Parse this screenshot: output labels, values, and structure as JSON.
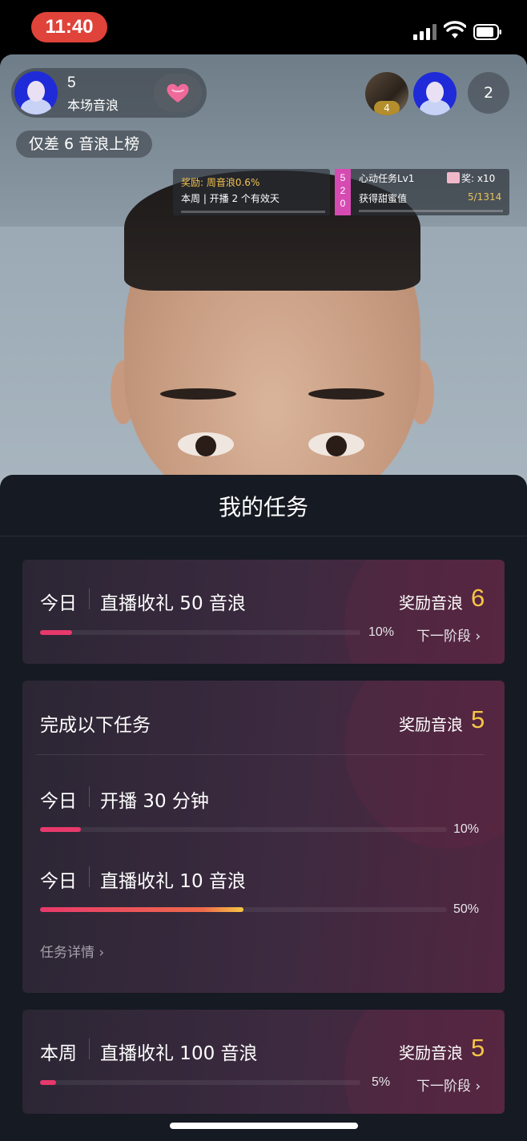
{
  "status_bar": {
    "time": "11:40"
  },
  "live": {
    "host_score": "5",
    "host_score_label": "本场音浪",
    "rank_tip": "仅差 6 音浪上榜",
    "viewer_badge": "4",
    "viewer_count": "2",
    "reward_card": {
      "line1": "奖励: 周音浪0.6%",
      "line2": "本周 | 开播 2 个有效天"
    },
    "heart_task": {
      "badge": [
        "5",
        "2",
        "0"
      ],
      "title": "心动任务Lv1",
      "prize": "奖: x10",
      "subtitle": "获得甜蜜值",
      "progress": "5/1314"
    }
  },
  "panel": {
    "title": "我的任务",
    "task_daily_gift": {
      "period": "今日",
      "name": "直播收礼 50 音浪",
      "reward_label": "奖励音浪",
      "reward_value": "6",
      "progress": 0.1,
      "percent": "10%",
      "next_stage": "下一阶段"
    },
    "task_group": {
      "title": "完成以下任务",
      "reward_label": "奖励音浪",
      "reward_value": "5",
      "items": [
        {
          "period": "今日",
          "name": "开播 30 分钟",
          "progress": 0.1,
          "percent": "10%"
        },
        {
          "period": "今日",
          "name": "直播收礼 10 音浪",
          "progress": 0.5,
          "percent": "50%"
        }
      ],
      "detail_link": "任务详情"
    },
    "task_weekly_gift": {
      "period": "本周",
      "name": "直播收礼 100 音浪",
      "reward_label": "奖励音浪",
      "reward_value": "5",
      "progress": 0.05,
      "percent": "5%",
      "next_stage": "下一阶段"
    }
  },
  "colors": {
    "accent": "#f6c644",
    "progress": "#e8396c",
    "status_time_bg": "#e0433a"
  }
}
